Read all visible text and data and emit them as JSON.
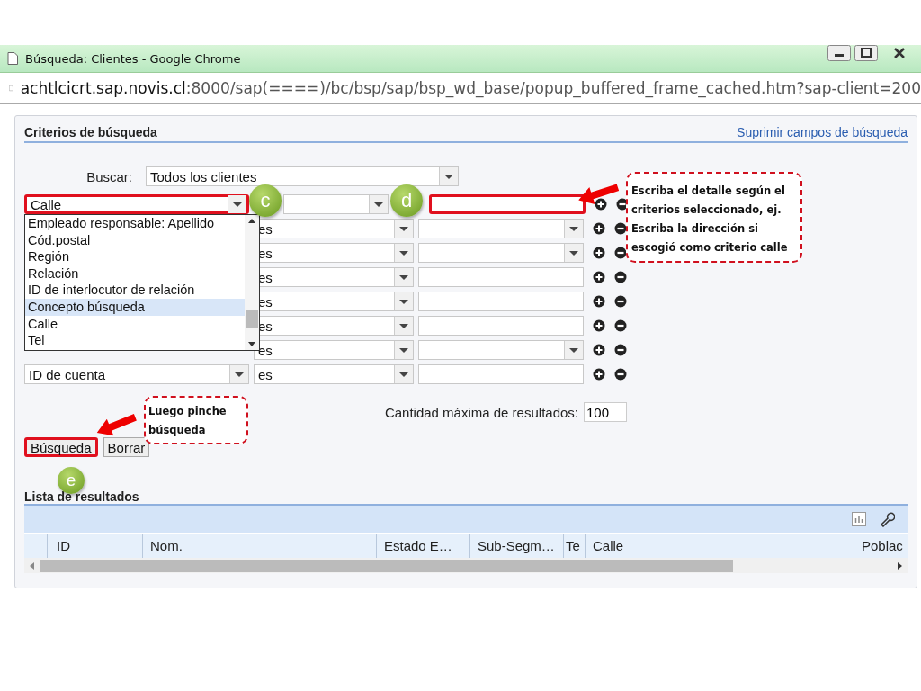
{
  "browser": {
    "title": "Búsqueda: Clientes - Google Chrome",
    "url_host": "achtlcicrt.sap.novis.cl",
    "url_rest": ":8000/sap(====)/bc/bsp/sap/bsp_wd_base/popup_buffered_frame_cached.htm?sap-client=200"
  },
  "criteria": {
    "title": "Criterios de búsqueda",
    "link": "Suprimir campos de búsqueda",
    "search_label": "Buscar:",
    "search_value": "Todos los clientes",
    "rows": [
      {
        "field": "Calle",
        "kind": "text",
        "highlighted": true
      },
      {
        "operator": "es",
        "kind": "select",
        "highlighted": false
      },
      {
        "operator": "es",
        "kind": "select",
        "highlighted": false
      },
      {
        "operator": "es",
        "kind": "text",
        "highlighted": false
      },
      {
        "operator": "es",
        "kind": "text",
        "highlighted": false
      },
      {
        "operator": "es",
        "kind": "text",
        "highlighted": false
      },
      {
        "operator": "es",
        "kind": "select",
        "highlighted": false
      },
      {
        "field": "ID de cuenta",
        "operator": "es",
        "kind": "text",
        "highlighted": false
      }
    ]
  },
  "dropdown": {
    "items": [
      {
        "label": "Empleado responsable: Apellido",
        "selected": false
      },
      {
        "label": "Cód.postal",
        "selected": false
      },
      {
        "label": "Región",
        "selected": false
      },
      {
        "label": "Relación",
        "selected": false
      },
      {
        "label": "ID de interlocutor de relación",
        "selected": false
      },
      {
        "label": "Concepto búsqueda",
        "selected": true
      },
      {
        "label": "Calle",
        "selected": false
      },
      {
        "label": "Tel",
        "selected": false
      }
    ]
  },
  "max_results": {
    "label": "Cantidad máxima de resultados:",
    "value": "100"
  },
  "buttons": [
    {
      "label": "Búsqueda",
      "highlighted": true
    },
    {
      "label": "Borrar",
      "highlighted": false
    }
  ],
  "results": {
    "title": "Lista de resultados",
    "columns": [
      "ID",
      "Nom.",
      "Estado E…",
      "Sub-Segm…",
      "Te",
      "Calle",
      "Poblac"
    ]
  },
  "annotations": [
    {
      "kind": "marker",
      "label": "c"
    },
    {
      "kind": "marker",
      "label": "d"
    },
    {
      "kind": "callout",
      "text": "Escriba el detalle según el criterios seleccionado, ej. Escriba la dirección si escogió como criterio calle"
    },
    {
      "kind": "callout",
      "text": "Luego pinche búsqueda"
    },
    {
      "kind": "marker",
      "label": "e"
    }
  ]
}
